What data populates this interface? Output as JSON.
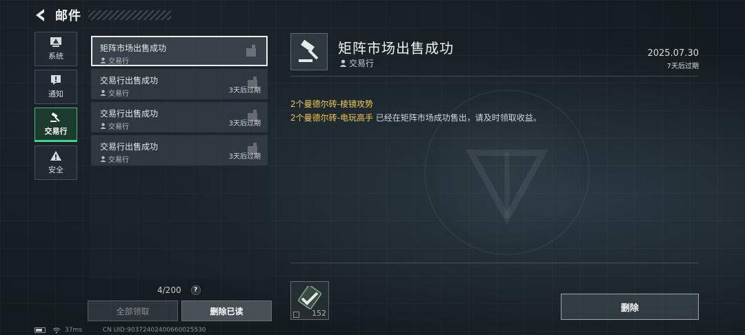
{
  "header": {
    "title": "邮件"
  },
  "categories": [
    {
      "label": "系统",
      "icon": "system-icon"
    },
    {
      "label": "通知",
      "icon": "notice-icon"
    },
    {
      "label": "交易行",
      "icon": "gavel-icon",
      "active": true
    },
    {
      "label": "安全",
      "icon": "warning-icon"
    }
  ],
  "mails": [
    {
      "title": "矩阵市场出售成功",
      "sender": "交易行",
      "expiry": ""
    },
    {
      "title": "交易行出售成功",
      "sender": "交易行",
      "expiry": "3天后过期"
    },
    {
      "title": "交易行出售成功",
      "sender": "交易行",
      "expiry": "3天后过期"
    },
    {
      "title": "交易行出售成功",
      "sender": "交易行",
      "expiry": "3天后过期"
    }
  ],
  "counter": "4/200",
  "help": "?",
  "buttons": {
    "claim_all": "全部领取",
    "delete_read": "删除已读",
    "delete": "删除"
  },
  "status": {
    "latency": "37ms",
    "uid": "CN UID:903724024006600255​30"
  },
  "detail": {
    "title": "矩阵市场出售成功",
    "sender": "交易行",
    "date": "2025.07.30",
    "expiry": "7天后过期",
    "line1_highlight": "2个曼德尔砖-棱镜攻势",
    "line2_highlight": "2个曼德尔砖-电玩高手",
    "line2_text": " 已经在矩阵市场成功售出，请及时领取收益。"
  },
  "attachment": {
    "count": "152",
    "icon": "currency-card-icon"
  },
  "colors": {
    "accent": "#3fd68a",
    "highlight": "#f2c94c"
  }
}
